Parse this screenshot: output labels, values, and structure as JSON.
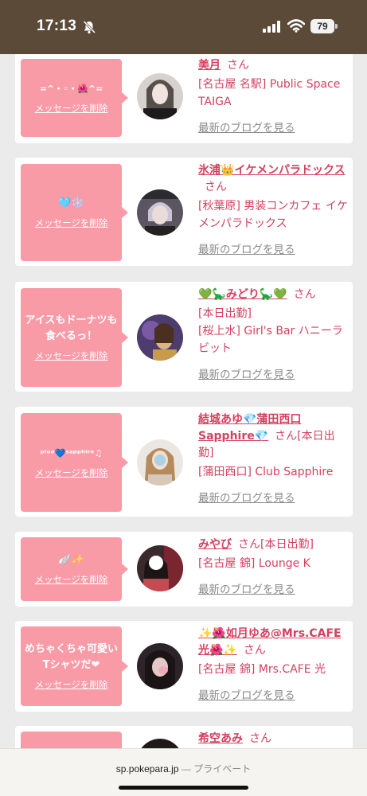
{
  "status_bar": {
    "time": "17:13",
    "battery": "79"
  },
  "delete_label": "メッセージを削除",
  "blog_label": "最新のブログを見る",
  "san": "さん",
  "cards": [
    {
      "message": "=^・◦・🌺^=",
      "name": "美月",
      "after_name": "",
      "place": "[名古屋 名駅] Public Space TAIGA"
    },
    {
      "message": "🩵❄️",
      "name": "氷浦👑イケメンパラドックス",
      "after_name": "",
      "place": "[秋葉原] 男装コンカフェ イケメンパラドックス"
    },
    {
      "message": "アイスもドーナツも食べるっ！",
      "name": "💚🦕みどり🦕💚",
      "after_name": "",
      "place": "[本日出勤]\n[桜上水] Girl's Bar ハニーラビット"
    },
    {
      "message": "ᵖˡᵘᵉ💙ˢᵃᵖᵖʰⁱʳᵉ♫",
      "name": "結城あゆ💎蒲田西口Sapphire💎",
      "after_name": "[本日出勤]",
      "place": "[蒲田西口] Club Sapphire"
    },
    {
      "message": "🪽✨",
      "name": "みやび",
      "after_name": "[本日出勤]",
      "place": "[名古屋 錦] Lounge K"
    },
    {
      "message": "めちゃくちゃ可愛いTシャツだ❤︎",
      "name": "✨🌺如月ゆあ@Mrs.CAFE光🌺✨",
      "after_name": "",
      "place": "[名古屋 錦] Mrs.CAFE 光"
    },
    {
      "message": "🎀",
      "name": "希空あみ",
      "after_name": "",
      "place": ""
    }
  ],
  "browser": {
    "domain": "sp.pokepara.jp",
    "privacy": "— プライベート"
  },
  "colors": {
    "header": "#5c4a39",
    "bubble": "#f99aa7",
    "link": "#d3415f"
  }
}
